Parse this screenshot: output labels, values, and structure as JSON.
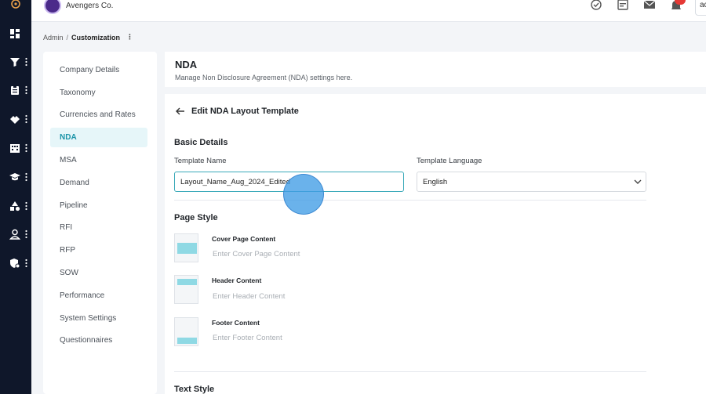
{
  "topbar": {
    "brand_name": "Avengers Co.",
    "user_initials": "ac",
    "icons": [
      "check-circle-icon",
      "calendar-icon",
      "mail-icon",
      "bell-icon"
    ]
  },
  "breadcrumb": {
    "root": "Admin",
    "separator": "/",
    "current": "Customization",
    "kebab": "⋮"
  },
  "rail": {
    "icons": [
      "dashboard-icon",
      "filter-icon",
      "clipboard-icon",
      "handshake-icon",
      "building-icon",
      "graduation-cap-icon",
      "shapes-icon",
      "user-icon",
      "shield-gear-icon"
    ]
  },
  "subnav": {
    "items": [
      {
        "label": "Company Details",
        "active": false
      },
      {
        "label": "Taxonomy",
        "active": false
      },
      {
        "label": "Currencies and Rates",
        "active": false
      },
      {
        "label": "NDA",
        "active": true
      },
      {
        "label": "MSA",
        "active": false
      },
      {
        "label": "Demand",
        "active": false
      },
      {
        "label": "Pipeline",
        "active": false
      },
      {
        "label": "RFI",
        "active": false
      },
      {
        "label": "RFP",
        "active": false
      },
      {
        "label": "SOW",
        "active": false
      },
      {
        "label": "Performance",
        "active": false
      },
      {
        "label": "System Settings",
        "active": false
      },
      {
        "label": "Questionnaires",
        "active": false
      }
    ]
  },
  "header": {
    "title": "NDA",
    "subtitle": "Manage Non Disclosure Agreement (NDA) settings here."
  },
  "editor": {
    "title": "Edit NDA Layout Template",
    "basic_details": {
      "section_title": "Basic Details",
      "template_name_label": "Template Name",
      "template_name_value": "Layout_Name_Aug_2024_Edited",
      "template_language_label": "Template Language",
      "template_language_value": "English"
    },
    "page_style": {
      "section_title": "Page Style",
      "cover": {
        "label": "Cover Page Content",
        "placeholder": "Enter Cover Page Content"
      },
      "header": {
        "label": "Header Content",
        "placeholder": "Enter Header Content"
      },
      "footer": {
        "label": "Footer Content",
        "placeholder": "Enter Footer Content"
      }
    },
    "text_style": {
      "section_title": "Text Style"
    }
  },
  "colors": {
    "rail_bg": "#0f172a",
    "accent": "#1b94a8",
    "active_nav_bg": "#e6f6f9",
    "notification_badge": "#e53935",
    "thumb_band": "#8fd9e4"
  }
}
